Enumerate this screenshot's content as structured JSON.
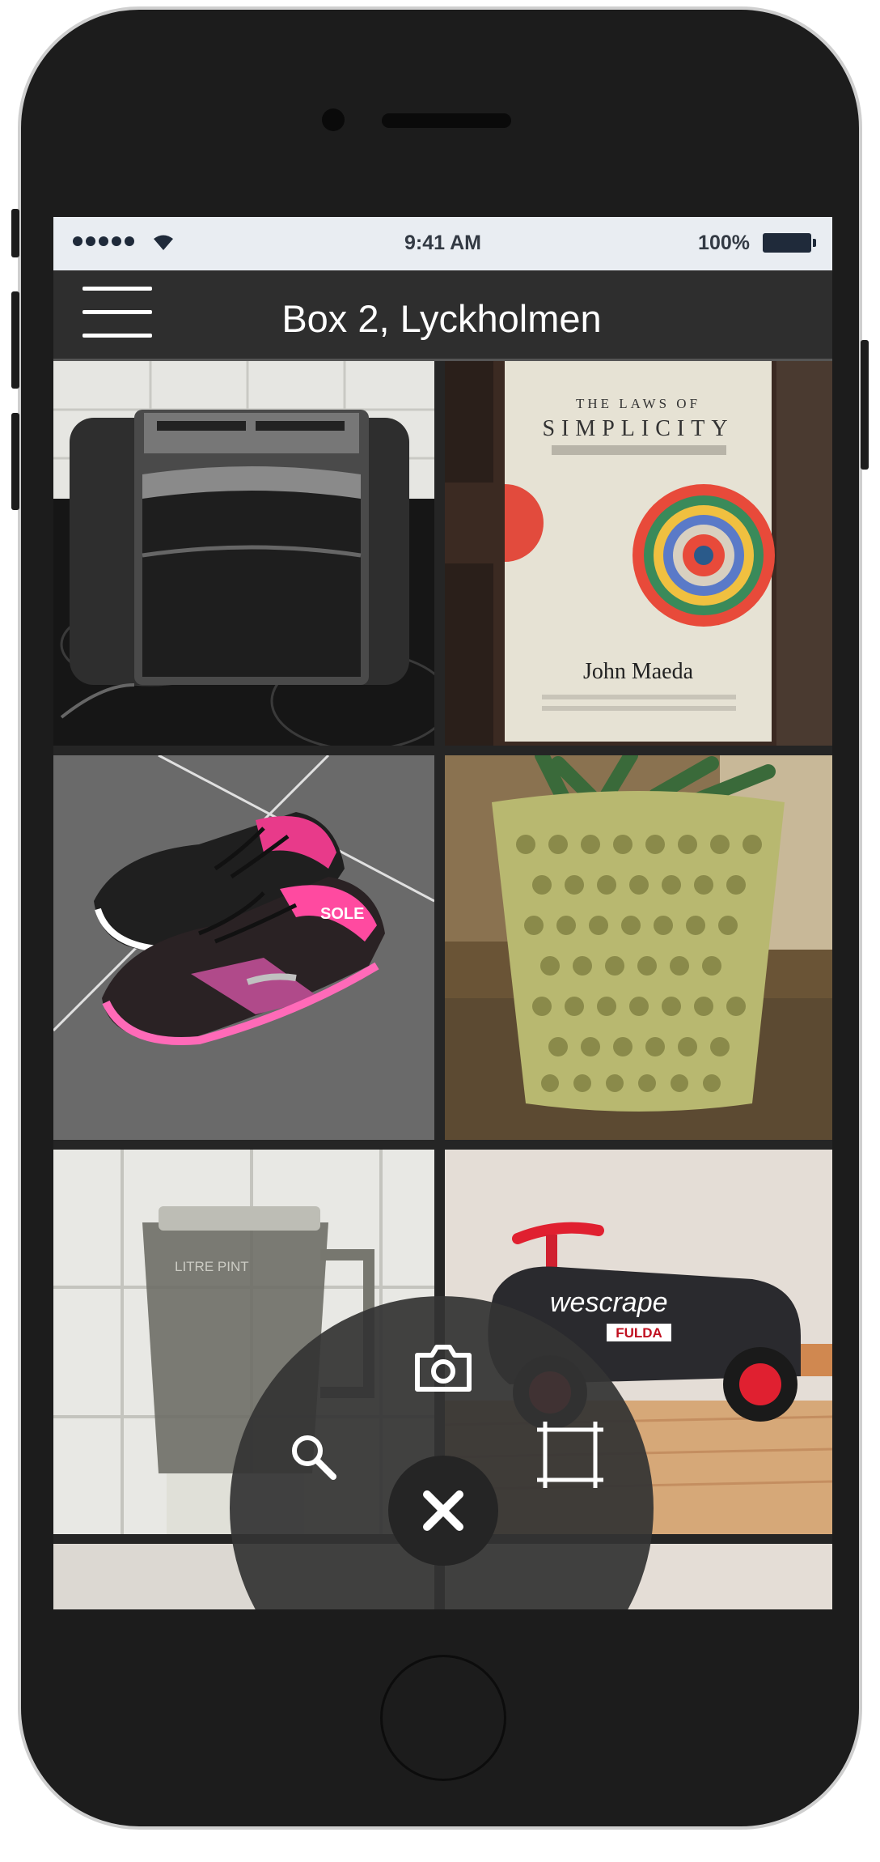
{
  "status_bar": {
    "time": "9:41 AM",
    "battery": "100%"
  },
  "app_bar": {
    "title": "Box 2, Lyckholmen"
  },
  "items": [
    {
      "photo": "toaster"
    },
    {
      "photo": "book",
      "book_title": "THE LAWS OF",
      "book_title_big": "SIMPLICITY",
      "book_author": "John Maeda"
    },
    {
      "photo": "sneakers",
      "sole_text": "SOLE"
    },
    {
      "photo": "flower-pot"
    },
    {
      "photo": "blender",
      "blender_marks": "LITRE  PINT"
    },
    {
      "photo": "ride-on-car",
      "car_text": "wescrape",
      "car_sticker": "FULDA"
    }
  ],
  "fab_menu": {
    "actions": [
      "camera-icon",
      "search-icon",
      "crop-frame-icon",
      "close-icon"
    ]
  },
  "colors": {
    "app_bar": "#2e2e2e",
    "status_bar": "#e9edf2",
    "fab_background": "#343434"
  }
}
